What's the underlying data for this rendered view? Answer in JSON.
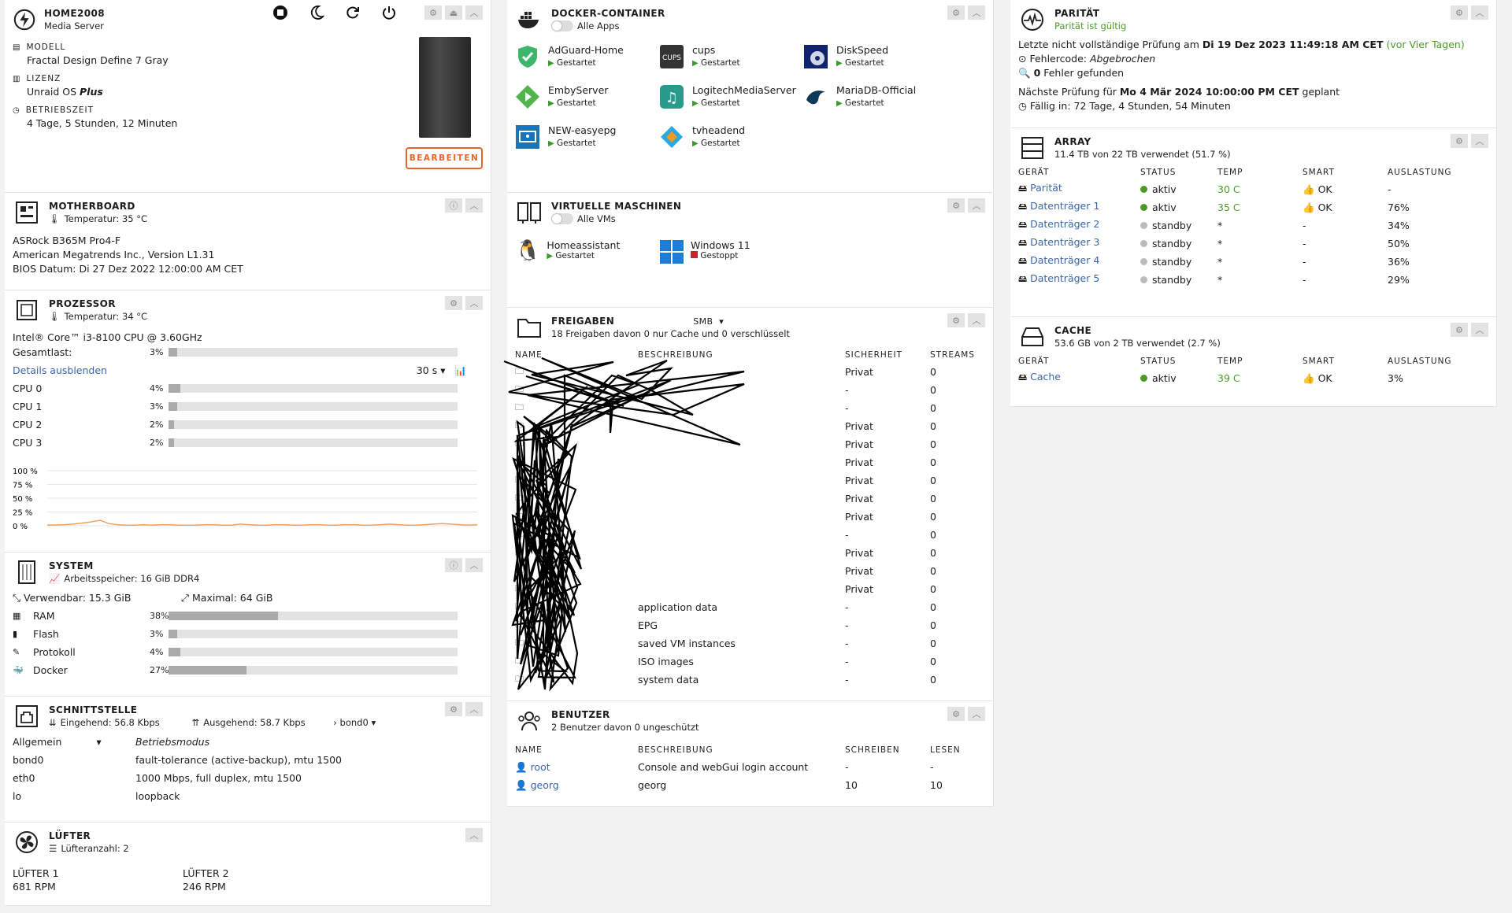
{
  "server": {
    "name": "HOME2008",
    "desc": "Media Server",
    "model_label": "MODELL",
    "model": "Fractal Design Define 7 Gray",
    "license_label": "LIZENZ",
    "license": "Unraid OS",
    "license_tier": "Plus",
    "uptime_label": "BETRIEBSZEIT",
    "uptime": "4 Tage, 5 Stunden, 12 Minuten",
    "edit": "BEARBEITEN"
  },
  "motherboard": {
    "title": "MOTHERBOARD",
    "temp": "Temperatur: 35 °C",
    "name": "ASRock B365M Pro4-F",
    "bios_vendor": "American Megatrends Inc., Version L1.31",
    "bios_date": "BIOS Datum: Di 27 Dez 2022 12:00:00 AM CET"
  },
  "cpu": {
    "title": "PROZESSOR",
    "temp": "Temperatur: 34 °C",
    "model": "Intel® Core™ i3-8100 CPU @ 3.60GHz",
    "total_label": "Gesamtlast:",
    "total": "3%",
    "total_value": 3,
    "details": "Details ausblenden",
    "interval": "30 s",
    "cores": [
      {
        "name": "CPU 0",
        "pct": "4%",
        "value": 4
      },
      {
        "name": "CPU 1",
        "pct": "3%",
        "value": 3
      },
      {
        "name": "CPU 2",
        "pct": "2%",
        "value": 2
      },
      {
        "name": "CPU 3",
        "pct": "2%",
        "value": 2
      }
    ],
    "graph_ticks": [
      "100 %",
      "75 %",
      "50 %",
      "25 %",
      "0 %"
    ],
    "graph_values": [
      1,
      1.5,
      2,
      3,
      5,
      7,
      10,
      4,
      2,
      1,
      1,
      2,
      1,
      2,
      2,
      1,
      1,
      1,
      2,
      2,
      1,
      1,
      3,
      2,
      1,
      1,
      2,
      2,
      1,
      1,
      2,
      2,
      1,
      1,
      2,
      2,
      1,
      1,
      2,
      3,
      2,
      1,
      1,
      2,
      3,
      4,
      3,
      2,
      1,
      2
    ]
  },
  "system": {
    "title": "SYSTEM",
    "memory": "Arbeitsspeicher: 16 GiB DDR4",
    "usable": "Verwendbar: 15.3 GiB",
    "max": "Maximal: 64 GiB",
    "rows": [
      {
        "name": "RAM",
        "pct": "38%",
        "value": 38
      },
      {
        "name": "Flash",
        "pct": "3%",
        "value": 3
      },
      {
        "name": "Protokoll",
        "pct": "4%",
        "value": 4
      },
      {
        "name": "Docker",
        "pct": "27%",
        "value": 27
      }
    ]
  },
  "net": {
    "title": "SCHNITTSTELLE",
    "in": "Eingehend: 56.8 Kbps",
    "out": "Ausgehend: 58.7 Kbps",
    "iface": "bond0",
    "mode_select": "Allgemein",
    "mode_head": "Betriebsmodus",
    "rows": [
      {
        "name": "bond0",
        "value": "fault-tolerance (active-backup), mtu 1500"
      },
      {
        "name": "eth0",
        "value": "1000 Mbps, full duplex, mtu 1500"
      },
      {
        "name": "lo",
        "value": "loopback"
      }
    ]
  },
  "fans": {
    "title": "LÜFTER",
    "count": "Lüfteranzahl: 2",
    "items": [
      {
        "name": "LÜFTER 1",
        "rpm": "681 RPM"
      },
      {
        "name": "LÜFTER 2",
        "rpm": "246 RPM"
      }
    ]
  },
  "docker": {
    "title": "DOCKER-CONTAINER",
    "toggle": "Alle Apps",
    "apps": [
      {
        "name": "AdGuard-Home",
        "status": "Gestartet"
      },
      {
        "name": "cups",
        "status": "Gestartet"
      },
      {
        "name": "DiskSpeed",
        "status": "Gestartet"
      },
      {
        "name": "EmbyServer",
        "status": "Gestartet"
      },
      {
        "name": "LogitechMediaServer",
        "status": "Gestartet"
      },
      {
        "name": "MariaDB-Official",
        "status": "Gestartet"
      },
      {
        "name": "NEW-easyepg",
        "status": "Gestartet"
      },
      {
        "name": "tvheadend",
        "status": "Gestartet"
      }
    ]
  },
  "vms": {
    "title": "VIRTUELLE MASCHINEN",
    "toggle": "Alle VMs",
    "items": [
      {
        "name": "Homeassistant",
        "status": "Gestartet"
      },
      {
        "name": "Windows 11",
        "status": "Gestoppt"
      }
    ]
  },
  "shares": {
    "title": "FREIGABEN",
    "proto": "SMB",
    "summary": "18 Freigaben davon 0 nur Cache und 0 verschlüsselt",
    "cols": [
      "NAME",
      "BESCHREIBUNG",
      "SICHERHEIT",
      "STREAMS"
    ],
    "rows": [
      {
        "desc": "",
        "sec": "Privat",
        "streams": "0"
      },
      {
        "desc": "",
        "sec": "-",
        "streams": "0"
      },
      {
        "desc": "",
        "sec": "-",
        "streams": "0"
      },
      {
        "desc": "",
        "sec": "Privat",
        "streams": "0"
      },
      {
        "desc": "",
        "sec": "Privat",
        "streams": "0"
      },
      {
        "desc": "",
        "sec": "Privat",
        "streams": "0"
      },
      {
        "desc": "",
        "sec": "Privat",
        "streams": "0"
      },
      {
        "desc": "",
        "sec": "Privat",
        "streams": "0"
      },
      {
        "desc": "",
        "sec": "Privat",
        "streams": "0"
      },
      {
        "desc": "",
        "sec": "-",
        "streams": "0"
      },
      {
        "desc": "",
        "sec": "Privat",
        "streams": "0"
      },
      {
        "desc": "",
        "sec": "Privat",
        "streams": "0"
      },
      {
        "desc": "",
        "sec": "Privat",
        "streams": "0"
      },
      {
        "desc": "application data",
        "sec": "-",
        "streams": "0"
      },
      {
        "desc": "EPG",
        "sec": "-",
        "streams": "0"
      },
      {
        "desc": "saved VM instances",
        "sec": "-",
        "streams": "0"
      },
      {
        "desc": "ISO images",
        "sec": "-",
        "streams": "0"
      },
      {
        "desc": "system data",
        "sec": "-",
        "streams": "0"
      }
    ]
  },
  "users": {
    "title": "BENUTZER",
    "summary": "2 Benutzer davon 0 ungeschützt",
    "cols": [
      "NAME",
      "BESCHREIBUNG",
      "SCHREIBEN",
      "LESEN"
    ],
    "rows": [
      {
        "name": "root",
        "desc": "Console and webGui login account",
        "write": "-",
        "read": "-"
      },
      {
        "name": "georg",
        "desc": "georg",
        "write": "10",
        "read": "10"
      }
    ]
  },
  "parity": {
    "title": "PARITÄT",
    "status": "Parität ist gültig",
    "last_pre": "Letzte nicht vollständige Prüfung am ",
    "last_date": "Di 19 Dez 2023 11:49:18 AM CET",
    "last_ago": "(vor Vier Tagen)",
    "error_pre": "Fehlercode: ",
    "error": "Abgebrochen",
    "found_n": "0",
    "found": " Fehler gefunden",
    "next_pre": "Nächste Prüfung für ",
    "next_date": "Mo 4 Mär 2024 10:00:00 PM CET",
    "next_post": " geplant",
    "due": "Fällig in: 72 Tage, 4 Stunden, 54 Minuten"
  },
  "array": {
    "title": "ARRAY",
    "summary": "11.4 TB von 22 TB verwendet (51.7 %)",
    "cols": [
      "GERÄT",
      "STATUS",
      "TEMP",
      "SMART",
      "AUSLASTUNG"
    ],
    "rows": [
      {
        "name": "Parität",
        "status": "aktiv",
        "state": "active",
        "temp": "30 C",
        "smart": "OK",
        "use": "-"
      },
      {
        "name": "Datenträger 1",
        "status": "aktiv",
        "state": "active",
        "temp": "35 C",
        "smart": "OK",
        "use": "76%"
      },
      {
        "name": "Datenträger 2",
        "status": "standby",
        "state": "standby",
        "temp": "*",
        "smart": "-",
        "use": "34%"
      },
      {
        "name": "Datenträger 3",
        "status": "standby",
        "state": "standby",
        "temp": "*",
        "smart": "-",
        "use": "50%"
      },
      {
        "name": "Datenträger 4",
        "status": "standby",
        "state": "standby",
        "temp": "*",
        "smart": "-",
        "use": "36%"
      },
      {
        "name": "Datenträger 5",
        "status": "standby",
        "state": "standby",
        "temp": "*",
        "smart": "-",
        "use": "29%"
      }
    ]
  },
  "cache": {
    "title": "CACHE",
    "summary": "53.6 GB von 2 TB verwendet (2.7 %)",
    "cols": [
      "GERÄT",
      "STATUS",
      "TEMP",
      "SMART",
      "AUSLASTUNG"
    ],
    "rows": [
      {
        "name": "Cache",
        "status": "aktiv",
        "state": "active",
        "temp": "39 C",
        "smart": "OK",
        "use": "3%"
      }
    ]
  },
  "colors": {
    "accent": "#e8662a",
    "link": "#3a66a8",
    "green": "#4c9a2a",
    "bar": "#aaaaaa",
    "graph": "#f0a25a"
  }
}
